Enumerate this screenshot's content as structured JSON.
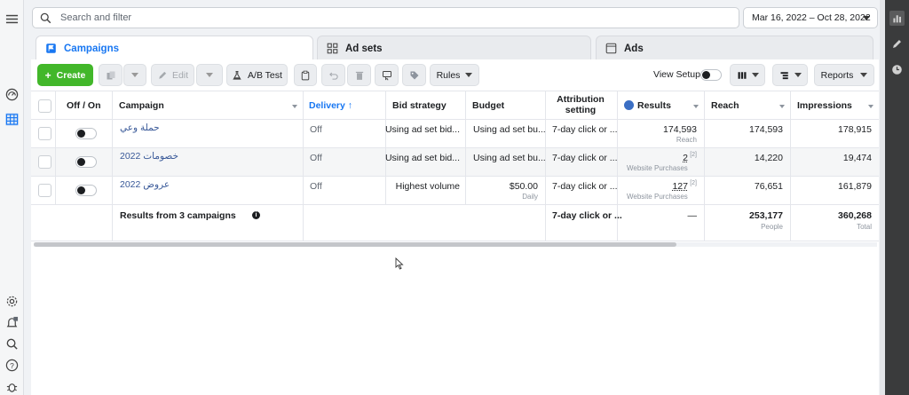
{
  "search": {
    "placeholder": "Search and filter"
  },
  "date_range": "Mar 16, 2022 – Oct 28, 2022",
  "tabs": [
    {
      "label": "Campaigns",
      "icon": "flag-icon",
      "active": true
    },
    {
      "label": "Ad sets",
      "icon": "grid-icon",
      "active": false
    },
    {
      "label": "Ads",
      "icon": "window-icon",
      "active": false
    }
  ],
  "toolbar": {
    "create": "Create",
    "edit": "Edit",
    "ab_test": "A/B Test",
    "rules": "Rules",
    "view_setup": "View Setup",
    "reports": "Reports"
  },
  "table": {
    "headers": {
      "off_on": "Off / On",
      "campaign": "Campaign",
      "delivery": "Delivery ↑",
      "bid_strategy": "Bid strategy",
      "budget": "Budget",
      "attribution": "Attribution setting",
      "results": "Results",
      "reach": "Reach",
      "impressions": "Impressions"
    },
    "rows": [
      {
        "campaign": "حملة وعي",
        "delivery": "Off",
        "bid_strategy": "Using ad set bid...",
        "budget": "Using ad set bu...",
        "attribution": "7-day click or ...",
        "results": "174,593",
        "results_note": "",
        "results_sub": "Reach",
        "reach": "174,593",
        "impressions": "178,915"
      },
      {
        "campaign": "خصومات 2022",
        "delivery": "Off",
        "bid_strategy": "Using ad set bid...",
        "budget": "Using ad set bu...",
        "attribution": "7-day click or ...",
        "results": "2",
        "results_note": "[2]",
        "results_sub": "Website Purchases",
        "reach": "14,220",
        "impressions": "19,474"
      },
      {
        "campaign": "عروض 2022",
        "delivery": "Off",
        "bid_strategy": "Highest volume",
        "budget": "$50.00",
        "budget_sub": "Daily",
        "attribution": "7-day click or ...",
        "results": "127",
        "results_note": "[2]",
        "results_sub": "Website Purchases",
        "reach": "76,651",
        "impressions": "161,879"
      }
    ],
    "summary": {
      "label": "Results from 3 campaigns",
      "attribution": "7-day click or ...",
      "results": "—",
      "reach": "253,177",
      "reach_sub": "People",
      "impressions": "360,268",
      "impressions_sub": "Total"
    }
  }
}
